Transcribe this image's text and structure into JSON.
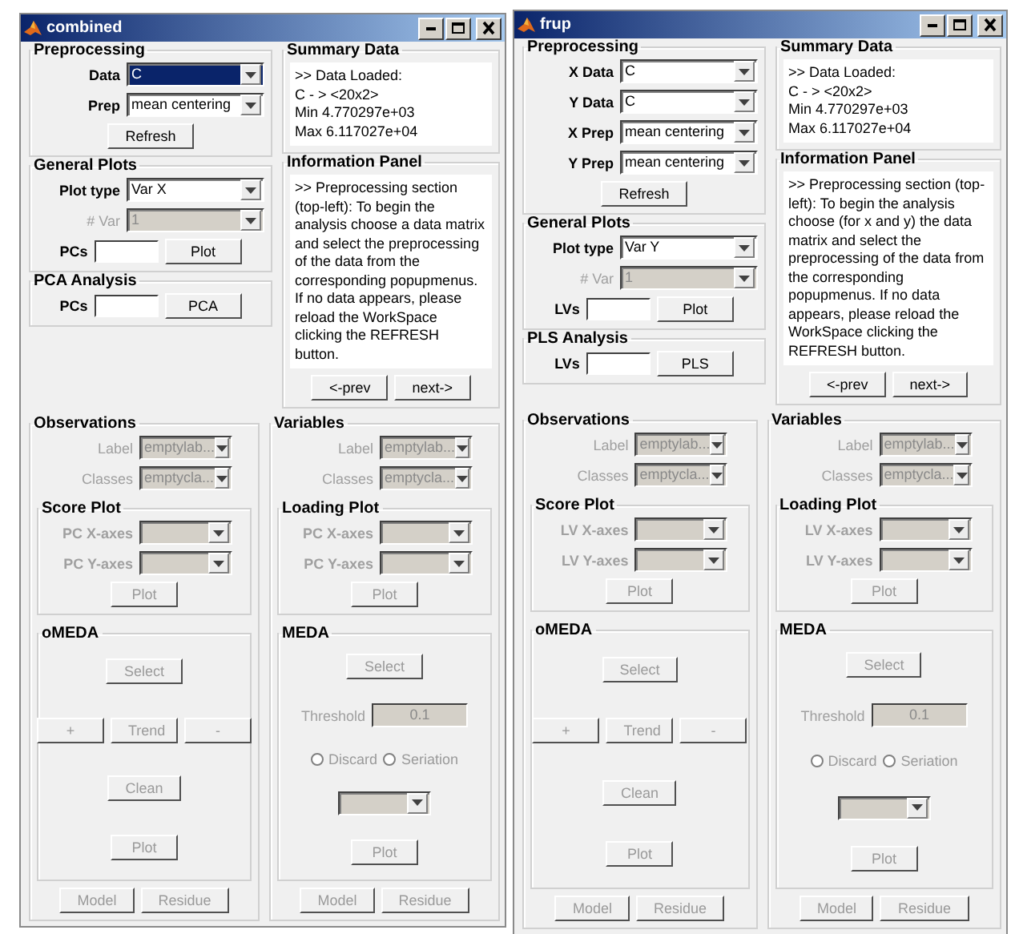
{
  "windows": [
    {
      "title": "combined",
      "top_left": [
        {
          "title": "Preprocessing",
          "items": [
            {
              "kind": "select",
              "label": "Data",
              "value": "C",
              "focused": true,
              "disabled": false
            },
            {
              "kind": "select",
              "label": "Prep",
              "value": "mean centering",
              "focused": false,
              "disabled": false
            },
            {
              "kind": "buttons",
              "buttons": [
                {
                  "label": "Refresh",
                  "disabled": false
                }
              ]
            }
          ]
        },
        {
          "title": "General Plots",
          "items": [
            {
              "kind": "select",
              "label": "Plot type",
              "value": "Var X",
              "focused": false,
              "disabled": false
            },
            {
              "kind": "select",
              "label": "# Var",
              "value": "1",
              "focused": false,
              "disabled": true
            },
            {
              "kind": "entry",
              "label": "PCs",
              "button": {
                "label": "Plot",
                "disabled": false
              }
            }
          ]
        },
        {
          "title": "PCA Analysis",
          "items": [
            {
              "kind": "entry",
              "label": "PCs",
              "button": {
                "label": "PCA",
                "disabled": false
              }
            }
          ]
        }
      ],
      "top_right": [
        {
          "title": "Summary Data",
          "items": [
            {
              "kind": "textbox",
              "lines": [
                ">>  Data Loaded:",
                "C - > <20x2>",
                "Min 4.770297e+03",
                "Max 6.117027e+04"
              ]
            }
          ]
        },
        {
          "title": "Information Panel",
          "items": [
            {
              "kind": "textbox",
              "lines": [
                ">>  Preprocessing section (top-left): To begin the analysis choose a data matrix and select the preprocessing of the data from the corresponding popupmenus. If no data appears, please reload the WorkSpace clicking the REFRESH button."
              ]
            },
            {
              "kind": "buttons",
              "buttons": [
                {
                  "label": "<-prev",
                  "disabled": false
                },
                {
                  "label": "next->",
                  "disabled": false
                }
              ]
            }
          ]
        }
      ],
      "bottom": [
        {
          "title": "Observations",
          "items": [
            {
              "kind": "select",
              "label": "Label",
              "value": "emptylab...",
              "focused": false,
              "disabled": true
            },
            {
              "kind": "select",
              "label": "Classes",
              "value": "emptycla...",
              "focused": false,
              "disabled": true
            },
            {
              "kind": "group",
              "title": "Score Plot",
              "items": [
                {
                  "kind": "select",
                  "label": "PC X-axes",
                  "focused": false,
                  "disabled": true
                },
                {
                  "kind": "select",
                  "label": "PC Y-axes",
                  "focused": false,
                  "disabled": true
                },
                {
                  "kind": "buttons",
                  "buttons": [
                    {
                      "label": "Plot",
                      "disabled": true
                    }
                  ]
                }
              ]
            },
            {
              "kind": "group",
              "title": "oMEDA",
              "items": [
                {
                  "kind": "buttons",
                  "buttons": [
                    {
                      "label": "Select",
                      "disabled": true
                    }
                  ]
                },
                {
                  "kind": "buttons",
                  "buttons": [
                    {
                      "label": "+",
                      "disabled": true
                    },
                    {
                      "label": "Trend",
                      "disabled": true
                    },
                    {
                      "label": "-",
                      "disabled": true
                    }
                  ]
                },
                {
                  "kind": "buttons",
                  "buttons": [
                    {
                      "label": "Clean",
                      "disabled": true
                    }
                  ]
                },
                {
                  "kind": "buttons",
                  "buttons": [
                    {
                      "label": "Plot",
                      "disabled": true
                    }
                  ]
                }
              ]
            },
            {
              "kind": "buttons",
              "buttons": [
                {
                  "label": "Model",
                  "disabled": true
                },
                {
                  "label": "Residue",
                  "disabled": true
                }
              ]
            }
          ]
        },
        {
          "title": "Variables",
          "items": [
            {
              "kind": "select",
              "label": "Label",
              "value": "emptylab...",
              "focused": false,
              "disabled": true
            },
            {
              "kind": "select",
              "label": "Classes",
              "value": "emptycla...",
              "focused": false,
              "disabled": true
            },
            {
              "kind": "group",
              "title": "Loading Plot",
              "items": [
                {
                  "kind": "select",
                  "label": "PC X-axes",
                  "focused": false,
                  "disabled": true
                },
                {
                  "kind": "select",
                  "label": "PC Y-axes",
                  "focused": false,
                  "disabled": true
                },
                {
                  "kind": "buttons",
                  "buttons": [
                    {
                      "label": "Plot",
                      "disabled": true
                    }
                  ]
                }
              ]
            },
            {
              "kind": "group",
              "title": "MEDA",
              "items": [
                {
                  "kind": "buttons",
                  "buttons": [
                    {
                      "label": "Select",
                      "disabled": true
                    }
                  ]
                },
                {
                  "kind": "threshold",
                  "label": "Threshold",
                  "value": "0.1",
                  "disabled": true
                },
                {
                  "kind": "radios",
                  "options": [
                    {
                      "label": "Discard",
                      "selected": false,
                      "disabled": true
                    },
                    {
                      "label": "Seriation",
                      "selected": false,
                      "disabled": true
                    }
                  ]
                },
                {
                  "kind": "select",
                  "focused": false,
                  "disabled": true
                },
                {
                  "kind": "buttons",
                  "buttons": [
                    {
                      "label": "Plot",
                      "disabled": true
                    }
                  ]
                }
              ]
            },
            {
              "kind": "buttons",
              "buttons": [
                {
                  "label": "Model",
                  "disabled": true
                },
                {
                  "label": "Residue",
                  "disabled": true
                }
              ]
            }
          ]
        }
      ]
    },
    {
      "title": "frup",
      "top_left": [
        {
          "title": "Preprocessing",
          "items": [
            {
              "kind": "select",
              "label": "X Data",
              "value": "C",
              "focused": false,
              "disabled": false
            },
            {
              "kind": "select",
              "label": "Y Data",
              "value": "C",
              "focused": false,
              "disabled": false
            },
            {
              "kind": "select",
              "label": "X Prep",
              "value": "mean centering",
              "focused": false,
              "disabled": false
            },
            {
              "kind": "select",
              "label": "Y Prep",
              "value": "mean centering",
              "focused": false,
              "disabled": false
            },
            {
              "kind": "buttons",
              "buttons": [
                {
                  "label": "Refresh",
                  "disabled": false
                }
              ]
            }
          ]
        },
        {
          "title": "General Plots",
          "items": [
            {
              "kind": "select",
              "label": "Plot type",
              "value": "Var Y",
              "focused": false,
              "disabled": false
            },
            {
              "kind": "select",
              "label": "# Var",
              "value": "1",
              "focused": false,
              "disabled": true
            },
            {
              "kind": "entry",
              "label": "LVs",
              "button": {
                "label": "Plot",
                "disabled": false
              }
            }
          ]
        },
        {
          "title": "PLS Analysis",
          "items": [
            {
              "kind": "entry",
              "label": "LVs",
              "button": {
                "label": "PLS",
                "disabled": false
              }
            }
          ]
        }
      ],
      "top_right": [
        {
          "title": "Summary Data",
          "items": [
            {
              "kind": "textbox",
              "lines": [
                ">>  Data Loaded:",
                "C - > <20x2>",
                "Min 4.770297e+03",
                "Max 6.117027e+04"
              ]
            }
          ]
        },
        {
          "title": "Information Panel",
          "items": [
            {
              "kind": "textbox",
              "lines": [
                ">>  Preprocessing section (top-left): To begin the analysis choose (for x and y) the data matrix and select the preprocessing of the data from the corresponding popupmenus. If no data appears, please reload the WorkSpace clicking the REFRESH button."
              ]
            },
            {
              "kind": "buttons",
              "buttons": [
                {
                  "label": "<-prev",
                  "disabled": false
                },
                {
                  "label": "next->",
                  "disabled": false
                }
              ]
            }
          ]
        }
      ],
      "bottom": [
        {
          "title": "Observations",
          "items": [
            {
              "kind": "select",
              "label": "Label",
              "value": "emptylab...",
              "focused": false,
              "disabled": true
            },
            {
              "kind": "select",
              "label": "Classes",
              "value": "emptycla...",
              "focused": false,
              "disabled": true
            },
            {
              "kind": "group",
              "title": "Score Plot",
              "items": [
                {
                  "kind": "select",
                  "label": "LV X-axes",
                  "focused": false,
                  "disabled": true
                },
                {
                  "kind": "select",
                  "label": "LV Y-axes",
                  "focused": false,
                  "disabled": true
                },
                {
                  "kind": "buttons",
                  "buttons": [
                    {
                      "label": "Plot",
                      "disabled": true
                    }
                  ]
                }
              ]
            },
            {
              "kind": "group",
              "title": "oMEDA",
              "items": [
                {
                  "kind": "buttons",
                  "buttons": [
                    {
                      "label": "Select",
                      "disabled": true
                    }
                  ]
                },
                {
                  "kind": "buttons",
                  "buttons": [
                    {
                      "label": "+",
                      "disabled": true
                    },
                    {
                      "label": "Trend",
                      "disabled": true
                    },
                    {
                      "label": "-",
                      "disabled": true
                    }
                  ]
                },
                {
                  "kind": "buttons",
                  "buttons": [
                    {
                      "label": "Clean",
                      "disabled": true
                    }
                  ]
                },
                {
                  "kind": "buttons",
                  "buttons": [
                    {
                      "label": "Plot",
                      "disabled": true
                    }
                  ]
                }
              ]
            },
            {
              "kind": "buttons",
              "buttons": [
                {
                  "label": "Model",
                  "disabled": true
                },
                {
                  "label": "Residue",
                  "disabled": true
                }
              ]
            }
          ]
        },
        {
          "title": "Variables",
          "items": [
            {
              "kind": "select",
              "label": "Label",
              "value": "emptylab...",
              "focused": false,
              "disabled": true
            },
            {
              "kind": "select",
              "label": "Classes",
              "value": "emptycla...",
              "focused": false,
              "disabled": true
            },
            {
              "kind": "group",
              "title": "Loading Plot",
              "items": [
                {
                  "kind": "select",
                  "label": "LV X-axes",
                  "focused": false,
                  "disabled": true
                },
                {
                  "kind": "select",
                  "label": "LV Y-axes",
                  "focused": false,
                  "disabled": true
                },
                {
                  "kind": "buttons",
                  "buttons": [
                    {
                      "label": "Plot",
                      "disabled": true
                    }
                  ]
                }
              ]
            },
            {
              "kind": "group",
              "title": "MEDA",
              "items": [
                {
                  "kind": "buttons",
                  "buttons": [
                    {
                      "label": "Select",
                      "disabled": true
                    }
                  ]
                },
                {
                  "kind": "threshold",
                  "label": "Threshold",
                  "value": "0.1",
                  "disabled": true
                },
                {
                  "kind": "radios",
                  "options": [
                    {
                      "label": "Discard",
                      "selected": false,
                      "disabled": true
                    },
                    {
                      "label": "Seriation",
                      "selected": false,
                      "disabled": true
                    }
                  ]
                },
                {
                  "kind": "select",
                  "focused": false,
                  "disabled": true
                },
                {
                  "kind": "buttons",
                  "buttons": [
                    {
                      "label": "Plot",
                      "disabled": true
                    }
                  ]
                }
              ]
            },
            {
              "kind": "buttons",
              "buttons": [
                {
                  "label": "Model",
                  "disabled": true
                },
                {
                  "label": "Residue",
                  "disabled": true
                }
              ]
            }
          ]
        }
      ]
    }
  ]
}
